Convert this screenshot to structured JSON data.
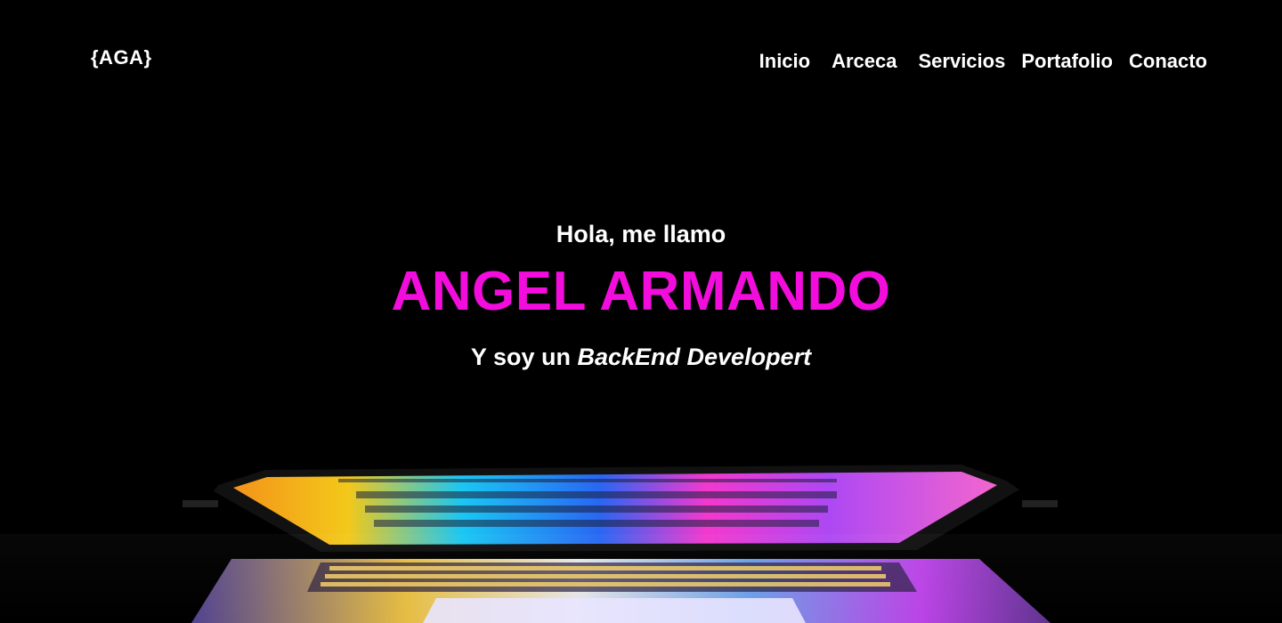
{
  "header": {
    "logo": "{AGA}",
    "nav": {
      "items": [
        "Inicio",
        "Arceca",
        "Servicios",
        "Portafolio",
        "Conacto"
      ]
    }
  },
  "hero": {
    "greeting": "Hola, me llamo",
    "name": "ANGEL ARMANDO",
    "role_prefix": "Y soy un",
    "role": "BackEnd Developert"
  },
  "colors": {
    "background": "#000000",
    "text": "#ffffff",
    "accent": "#f20ddc"
  }
}
